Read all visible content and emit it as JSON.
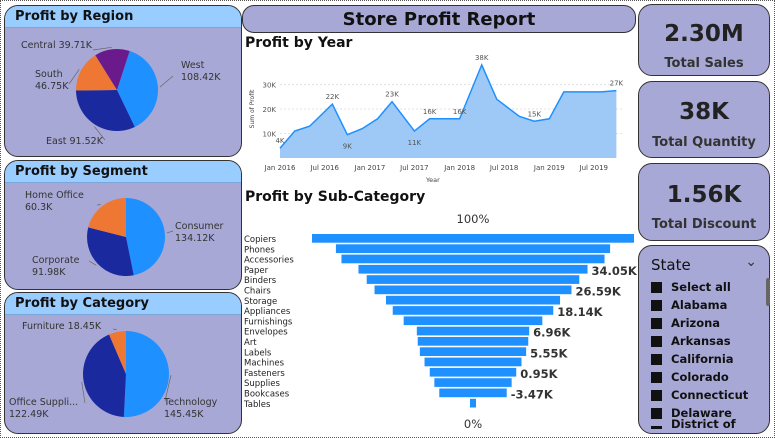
{
  "report_title": "Store Profit Report",
  "region": {
    "title": "Profit by Region",
    "chart_data": {
      "type": "pie",
      "labels": [
        "West",
        "East",
        "South",
        "Central"
      ],
      "values": [
        108.42,
        91.52,
        46.75,
        39.71
      ],
      "value_labels": [
        "108.42K",
        "91.52K",
        "46.75K",
        "39.71K"
      ],
      "colors": [
        "#1e90ff",
        "#1a2a9e",
        "#ee7733",
        "#6a1a8a"
      ]
    }
  },
  "segment": {
    "title": "Profit by Segment",
    "chart_data": {
      "type": "pie",
      "labels": [
        "Consumer",
        "Corporate",
        "Home Office"
      ],
      "values": [
        134.12,
        91.98,
        60.3
      ],
      "value_labels": [
        "134.12K",
        "91.98K",
        "60.3K"
      ],
      "colors": [
        "#1e90ff",
        "#1a2a9e",
        "#ee7733"
      ]
    }
  },
  "category": {
    "title": "Profit by Category",
    "chart_data": {
      "type": "pie",
      "labels": [
        "Technology",
        "Office Suppli...",
        "Furniture"
      ],
      "values": [
        145.45,
        122.49,
        18.45
      ],
      "value_labels": [
        "145.45K",
        "122.49K",
        "18.45K"
      ],
      "colors": [
        "#1e90ff",
        "#1a2a9e",
        "#ee7733"
      ]
    }
  },
  "year": {
    "title": "Profit by Year",
    "chart_data": {
      "type": "area",
      "x": [
        "2016-01",
        "2016-03",
        "2016-05",
        "2016-08",
        "2016-10",
        "2016-12",
        "2017-02",
        "2017-04",
        "2017-07",
        "2017-09",
        "2017-11",
        "2018-01",
        "2018-04",
        "2018-06",
        "2018-09",
        "2018-11",
        "2019-01",
        "2019-03",
        "2019-05",
        "2019-08",
        "2019-10"
      ],
      "values": [
        4,
        11,
        13,
        22,
        9.5,
        12,
        16,
        23,
        11,
        16,
        16,
        16,
        38,
        24,
        17,
        15,
        16,
        27,
        27,
        27,
        27.5
      ],
      "point_labels": [
        "4K",
        "",
        "",
        "22K",
        "9K",
        "",
        "",
        "23K",
        "11K",
        "16K",
        "",
        "16K",
        "38K",
        "",
        "",
        "15K",
        "",
        "",
        "",
        "",
        "27K"
      ],
      "ylabel": "Sum of Profit",
      "xlabel": "Year",
      "yticks": [
        "10K",
        "20K",
        "30K"
      ],
      "ytick_values": [
        10,
        20,
        30
      ],
      "ylim": [
        0,
        40
      ],
      "xticks": [
        "Jan 2016",
        "Jul 2016",
        "Jan 2017",
        "Jul 2017",
        "Jan 2018",
        "Jul 2018",
        "Jan 2019",
        "Jul 2019"
      ],
      "grid": true,
      "color": "#1e90ff"
    }
  },
  "subcategory": {
    "title": "Profit by Sub-Category",
    "top_label": "100%",
    "bottom_label": "0%",
    "chart_data": {
      "type": "funnel",
      "categories": [
        "Copiers",
        "Phones",
        "Accessories",
        "Paper",
        "Binders",
        "Chairs",
        "Storage",
        "Appliances",
        "Furnishings",
        "Envelopes",
        "Art",
        "Labels",
        "Machines",
        "Fasteners",
        "Supplies",
        "Bookcases",
        "Tables"
      ],
      "values": [
        55.62,
        44.52,
        41.94,
        34.05,
        30.22,
        26.59,
        21.28,
        18.14,
        13.06,
        6.96,
        6.53,
        5.55,
        3.38,
        0.95,
        -1.19,
        -3.47,
        -17.73
      ],
      "value_labels": [
        "",
        "",
        "",
        "34.05K",
        "",
        "26.59K",
        "",
        "18.14K",
        "",
        "6.96K",
        "",
        "5.55K",
        "",
        "0.95K",
        "",
        "-3.47K",
        ""
      ],
      "color": "#1e90ff"
    }
  },
  "kpis": [
    {
      "value": "2.30M",
      "label": "Total Sales"
    },
    {
      "value": "38K",
      "label": "Total Quantity"
    },
    {
      "value": "1.56K",
      "label": "Total Discount"
    }
  ],
  "state_filter": {
    "title": "State",
    "items": [
      "Select all",
      "Alabama",
      "Arizona",
      "Arkansas",
      "California",
      "Colorado",
      "Connecticut",
      "Delaware",
      "District of Columbia"
    ]
  }
}
